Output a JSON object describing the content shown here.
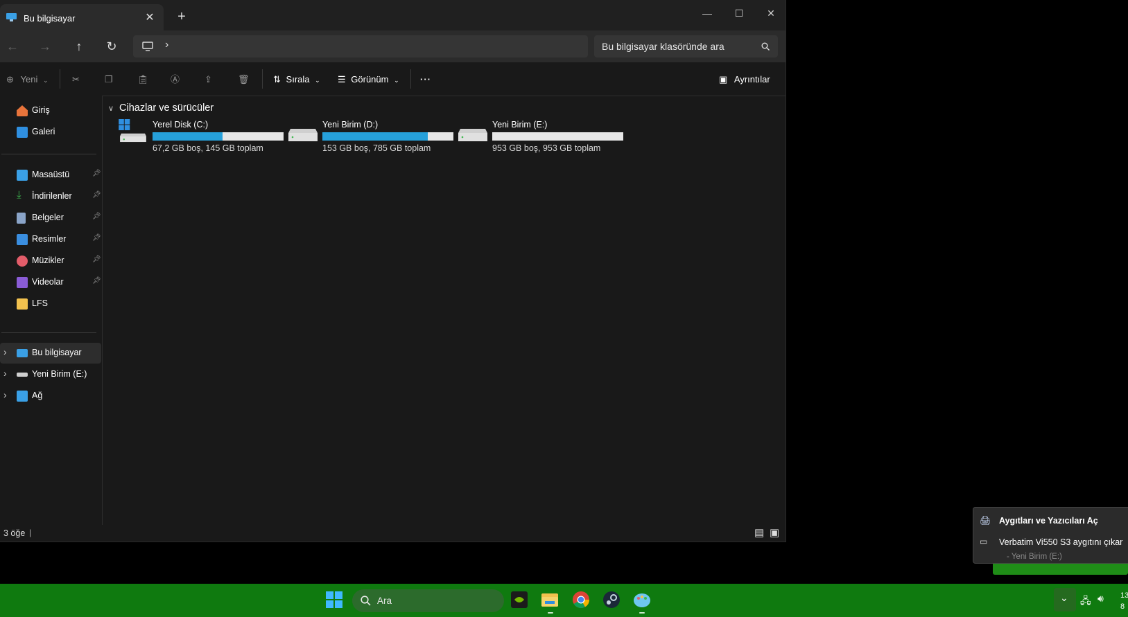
{
  "window": {
    "tab_title": "Bu bilgisayar",
    "close_tab": "✕",
    "new_tab": "+",
    "minimize": "—",
    "maximize": "☐",
    "close": "✕"
  },
  "navigation": {
    "address_separator": "›",
    "search_placeholder": "Bu bilgisayar klasöründe ara"
  },
  "toolbar": {
    "new_label": "Yeni",
    "sort_label": "Sırala",
    "view_label": "Görünüm",
    "more_label": "···",
    "details_label": "Ayrıntılar"
  },
  "sidebar": {
    "items": [
      {
        "label": "Giriş",
        "icon": "home-icon"
      },
      {
        "label": "Galeri",
        "icon": "gallery-icon"
      },
      {
        "label": "Masaüstü",
        "icon": "desktop-folder-icon",
        "pinned": true
      },
      {
        "label": "İndirilenler",
        "icon": "download-icon",
        "pinned": true
      },
      {
        "label": "Belgeler",
        "icon": "documents-icon",
        "pinned": true
      },
      {
        "label": "Resimler",
        "icon": "pictures-icon",
        "pinned": true
      },
      {
        "label": "Müzikler",
        "icon": "music-icon",
        "pinned": true
      },
      {
        "label": "Videolar",
        "icon": "videos-icon",
        "pinned": true
      },
      {
        "label": "LFS",
        "icon": "folder-icon"
      },
      {
        "label": "Bu bilgisayar",
        "icon": "this-pc-icon",
        "selected": true
      },
      {
        "label": "Yeni Birim (E:)",
        "icon": "drive-icon"
      },
      {
        "label": "Ağ",
        "icon": "network-icon"
      }
    ]
  },
  "content": {
    "group_title": "Cihazlar ve sürücüler",
    "drives": [
      {
        "name": "Yerel Disk (C:)",
        "info": "67,2 GB boş, 145 GB toplam",
        "used_fraction": 0.537
      },
      {
        "name": "Yeni Birim (D:)",
        "info": "153 GB boş, 785 GB toplam",
        "used_fraction": 0.805
      },
      {
        "name": "Yeni Birim (E:)",
        "info": "953 GB boş, 953 GB toplam",
        "used_fraction": 0.0
      }
    ]
  },
  "status": {
    "item_count": "3 öğe"
  },
  "popup": {
    "open_devices": "Aygıtları ve Yazıcıları Aç",
    "eject": "Verbatim Vi550 S3 aygıtını çıkar",
    "eject_volume": "-   Yeni Birim (E:)"
  },
  "taskbar": {
    "search_label": "Ara",
    "clock_line1": "13",
    "clock_line2": "8"
  },
  "colors": {
    "accent": "#26a0da",
    "taskbar": "#0f7a0f"
  }
}
